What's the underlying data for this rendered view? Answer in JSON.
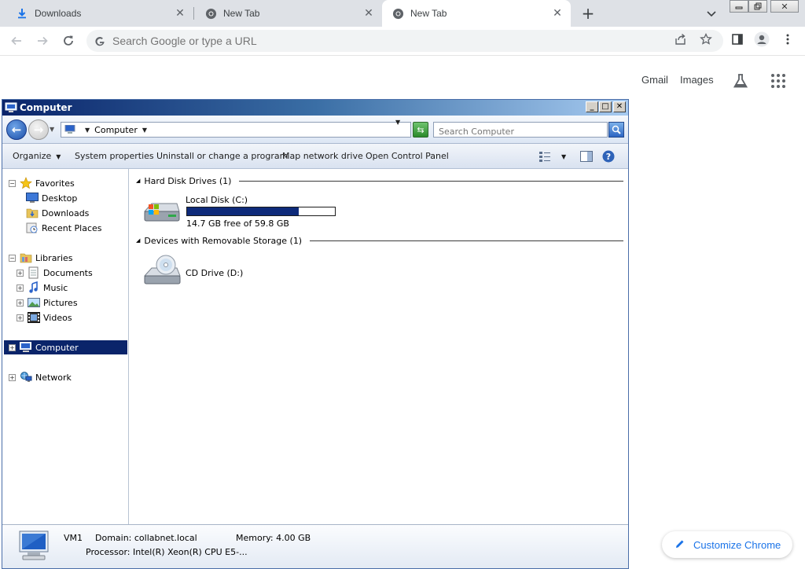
{
  "browser": {
    "tabs": [
      {
        "title": "Downloads",
        "icon": "download-icon",
        "active": false
      },
      {
        "title": "New Tab",
        "icon": "chrome-icon",
        "active": false
      },
      {
        "title": "New Tab",
        "icon": "chrome-icon",
        "active": true
      }
    ],
    "new_tab_label": "+",
    "omnibox": {
      "placeholder": "Search Google or type a URL"
    },
    "window_controls": [
      "minimize",
      "restore",
      "close"
    ]
  },
  "ntp": {
    "gmail": "Gmail",
    "images": "Images",
    "customize": "Customize Chrome"
  },
  "explorer": {
    "title": "Computer",
    "address": {
      "crumb": "Computer"
    },
    "search": {
      "placeholder": "Search Computer"
    },
    "commands": {
      "organize": "Organize",
      "system_properties": "System properties",
      "uninstall": "Uninstall or change a program",
      "map_drive": "Map network drive",
      "control_panel": "Open Control Panel"
    },
    "nav": {
      "favorites": "Favorites",
      "desktop": "Desktop",
      "downloads": "Downloads",
      "recent": "Recent Places",
      "libraries": "Libraries",
      "documents": "Documents",
      "music": "Music",
      "pictures": "Pictures",
      "videos": "Videos",
      "computer": "Computer",
      "network": "Network"
    },
    "groups": {
      "hdd_header": "Hard Disk Drives (1)",
      "removable_header": "Devices with Removable Storage (1)"
    },
    "drives": {
      "local": {
        "name": "Local Disk (C:)",
        "free_text": "14.7 GB free of 59.8 GB",
        "used_fraction": 0.754
      },
      "cd": {
        "name": "CD Drive (D:)"
      }
    },
    "details": {
      "name": "VM1",
      "domain": "Domain: collabnet.local",
      "memory": "Memory: 4.00 GB",
      "processor": "Processor: Intel(R) Xeon(R) CPU E5-..."
    }
  },
  "colors": {
    "accent": "#1a73e8",
    "selection": "#0a246a",
    "usage_fill": "#0e2a7a"
  }
}
